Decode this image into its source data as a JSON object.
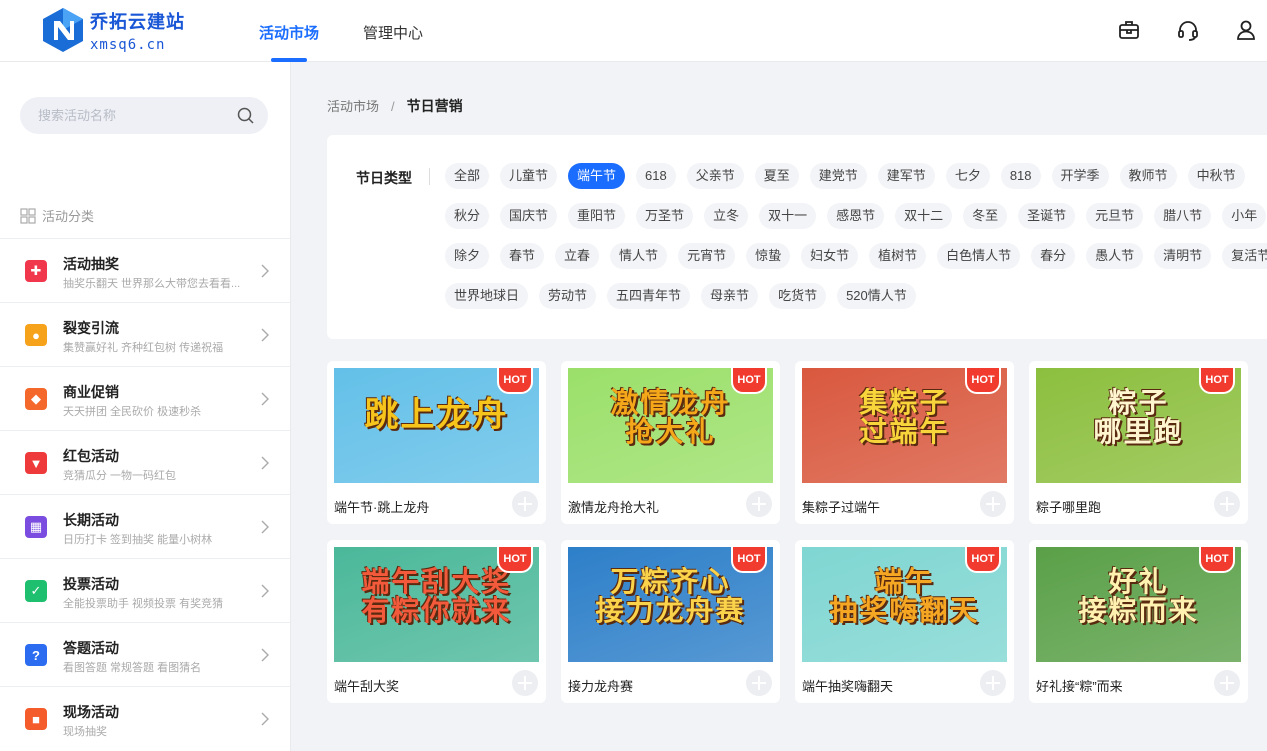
{
  "brand": {
    "name": "乔拓云建站",
    "domain": "xmsq6.cn"
  },
  "nav": {
    "tabs": [
      {
        "label": "活动市场"
      },
      {
        "label": "管理中心"
      }
    ]
  },
  "header_icons": [
    "briefcase-icon",
    "headset-icon",
    "user-icon"
  ],
  "sidebar": {
    "search_placeholder": "搜索活动名称",
    "category_title": "活动分类",
    "categories": [
      {
        "name": "活动抽奖",
        "desc": "抽奖乐翻天  世界那么大带您去看看...",
        "icon": "gift-icon",
        "color": "#f0374b"
      },
      {
        "name": "裂变引流",
        "desc": "集赞赢好礼  齐种红包树  传递祝福",
        "icon": "users-icon",
        "color": "#f7a21b"
      },
      {
        "name": "商业促销",
        "desc": "天天拼团  全民砍价  极速秒杀",
        "icon": "tag-icon",
        "color": "#f5682c"
      },
      {
        "name": "红包活动",
        "desc": "竞猜瓜分  一物一码红包",
        "icon": "red-envelope-icon",
        "color": "#ee3a3a"
      },
      {
        "name": "长期活动",
        "desc": "日历打卡  签到抽奖  能量小树林",
        "icon": "calendar-icon",
        "color": "#7a4de0"
      },
      {
        "name": "投票活动",
        "desc": "全能投票助手  视频投票  有奖竞猜",
        "icon": "vote-icon",
        "color": "#1fbf70"
      },
      {
        "name": "答题活动",
        "desc": "看图答题  常规答题  看图猜名",
        "icon": "question-icon",
        "color": "#2b6cf0"
      },
      {
        "name": "现场活动",
        "desc": "现场抽奖",
        "icon": "scene-icon",
        "color": "#f55c2b"
      }
    ]
  },
  "breadcrumb": {
    "root": "活动市场",
    "separator": "/",
    "current": "节日营销"
  },
  "filter": {
    "label": "节日类型",
    "rows": [
      [
        "全部",
        "儿童节",
        "端午节",
        "618",
        "父亲节",
        "夏至",
        "建党节",
        "建军节",
        "七夕",
        "818",
        "开学季",
        "教师节",
        "中秋节"
      ],
      [
        "秋分",
        "国庆节",
        "重阳节",
        "万圣节",
        "立冬",
        "双十一",
        "感恩节",
        "双十二",
        "冬至",
        "圣诞节",
        "元旦节",
        "腊八节",
        "小年"
      ],
      [
        "除夕",
        "春节",
        "立春",
        "情人节",
        "元宵节",
        "惊蛰",
        "妇女节",
        "植树节",
        "白色情人节",
        "春分",
        "愚人节",
        "清明节",
        "复活节"
      ],
      [
        "世界地球日",
        "劳动节",
        "五四青年节",
        "母亲节",
        "吃货节",
        "520情人节"
      ]
    ],
    "active": "端午节"
  },
  "cards": [
    {
      "name": "端午节·跳上龙舟",
      "thumb_text": "跳上龙舟",
      "badge": "HOT",
      "bg": "#63c0e8",
      "fg": "#f7c41b"
    },
    {
      "name": "激情龙舟抢大礼",
      "thumb_text": "激情龙舟\n抢大礼",
      "badge": "HOT",
      "bg": "#9be06a",
      "fg": "#f5a71a"
    },
    {
      "name": "集粽子过端午",
      "thumb_text": "集粽子\n过端午",
      "badge": "HOT",
      "bg": "#d9583e",
      "fg": "#f8d53b"
    },
    {
      "name": "粽子哪里跑",
      "thumb_text": "粽子\n哪里跑",
      "badge": "HOT",
      "bg": "#8cbf3e",
      "fg": "#fff6cf"
    },
    {
      "name": "端午刮大奖",
      "thumb_text": "端午刮大奖\n有粽你就来",
      "badge": "HOT",
      "bg": "#4bb89a",
      "fg": "#f25a3b"
    },
    {
      "name": "接力龙舟赛",
      "thumb_text": "万粽齐心\n接力龙舟赛",
      "badge": "HOT",
      "bg": "#2d7fc9",
      "fg": "#fbd34a"
    },
    {
      "name": "端午抽奖嗨翻天",
      "thumb_text": "端午\n抽奖嗨翻天",
      "badge": "HOT",
      "bg": "#7fd6d2",
      "fg": "#f5a623"
    },
    {
      "name": "好礼接“粽”而来",
      "thumb_text": "好礼\n接粽而来",
      "badge": "HOT",
      "bg": "#5aa048",
      "fg": "#fff2b0"
    }
  ]
}
